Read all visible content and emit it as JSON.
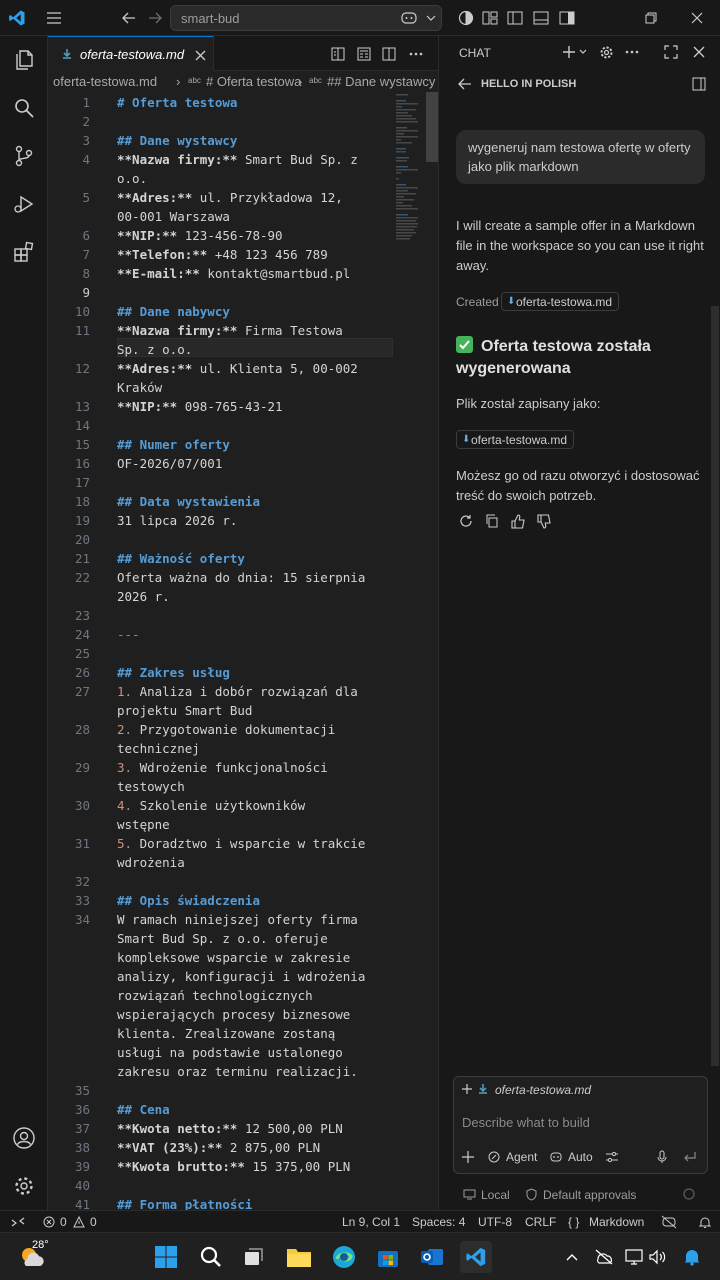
{
  "titlebar": {
    "search_text": "smart-bud"
  },
  "tab": {
    "label": "oferta-testowa.md"
  },
  "breadcrumb": {
    "file": "oferta-testowa.md",
    "sep": "›",
    "item1": "# Oferta testowa",
    "item2": "## Dane wystawcy",
    "abc": "abc"
  },
  "code_lines": [
    {
      "n": "1",
      "html": "<span class='h'># Oferta testowa</span>",
      "row": 0
    },
    {
      "n": "2",
      "html": "",
      "row": 1
    },
    {
      "n": "3",
      "html": "<span class='h'>## Dane wystawcy</span>",
      "row": 2
    },
    {
      "n": "4",
      "html": "<span class='b'>**Nazwa firmy:**</span> Smart Bud Sp. z\no.o.",
      "row": 3
    },
    {
      "n": "5",
      "html": "<span class='b'>**Adres:**</span> ul. Przykładowa 12,\n00-001 Warszawa",
      "row": 5
    },
    {
      "n": "6",
      "html": "<span class='b'>**NIP:**</span> 123-456-78-90",
      "row": 7
    },
    {
      "n": "7",
      "html": "<span class='b'>**Telefon:**</span> +48 123 456 789",
      "row": 8
    },
    {
      "n": "8",
      "html": "<span class='b'>**E-mail:**</span> kontakt@smartbud.pl",
      "row": 9
    },
    {
      "n": "9",
      "html": "",
      "row": 10,
      "cur": true
    },
    {
      "n": "10",
      "html": "<span class='h'>## Dane nabywcy</span>",
      "row": 11
    },
    {
      "n": "11",
      "html": "<span class='b'>**Nazwa firmy:**</span> Firma Testowa\nSp. z o.o.",
      "row": 12
    },
    {
      "n": "12",
      "html": "<span class='b'>**Adres:**</span> ul. Klienta 5, 00-002\nKraków",
      "row": 14
    },
    {
      "n": "13",
      "html": "<span class='b'>**NIP:**</span> 098-765-43-21",
      "row": 16
    },
    {
      "n": "14",
      "html": "",
      "row": 17
    },
    {
      "n": "15",
      "html": "<span class='h'>## Numer oferty</span>",
      "row": 18
    },
    {
      "n": "16",
      "html": "OF-2026/07/001",
      "row": 19
    },
    {
      "n": "17",
      "html": "",
      "row": 20
    },
    {
      "n": "18",
      "html": "<span class='h'>## Data wystawienia</span>",
      "row": 21
    },
    {
      "n": "19",
      "html": "31 lipca 2026 r.",
      "row": 22
    },
    {
      "n": "20",
      "html": "",
      "row": 23
    },
    {
      "n": "21",
      "html": "<span class='h'>## Ważność oferty</span>",
      "row": 24
    },
    {
      "n": "22",
      "html": "Oferta ważna do dnia: 15 sierpnia\n2026 r.",
      "row": 25
    },
    {
      "n": "23",
      "html": "",
      "row": 27
    },
    {
      "n": "24",
      "html": "<span class='hr'>---</span>",
      "row": 28
    },
    {
      "n": "25",
      "html": "",
      "row": 29
    },
    {
      "n": "26",
      "html": "<span class='h'>## Zakres usług</span>",
      "row": 30
    },
    {
      "n": "27",
      "html": "<span class='num'>1.</span> Analiza i dobór rozwiązań dla\nprojektu Smart Bud",
      "row": 31
    },
    {
      "n": "28",
      "html": "<span class='num'>2.</span> Przygotowanie dokumentacji\ntechnicznej",
      "row": 33
    },
    {
      "n": "29",
      "html": "<span class='num'>3.</span> Wdrożenie funkcjonalności\ntestowych",
      "row": 35
    },
    {
      "n": "30",
      "html": "<span class='num'>4.</span> Szkolenie użytkowników\nwstępne",
      "row": 37
    },
    {
      "n": "31",
      "html": "<span class='num'>5.</span> Doradztwo i wsparcie w trakcie\nwdrożenia",
      "row": 39
    },
    {
      "n": "32",
      "html": "",
      "row": 41
    },
    {
      "n": "33",
      "html": "<span class='h'>## Opis świadczenia</span>",
      "row": 42
    },
    {
      "n": "34",
      "html": "W ramach niniejszej oferty firma\nSmart Bud Sp. z o.o. oferuje\nkompleksowe wsparcie w zakresie\nanalizy, konfiguracji i wdrożenia\nrozwiązań technologicznych\nwspierających procesy biznesowe\nklienta. Zrealizowane zostaną\nusługi na podstawie ustalonego\nzakresu oraz terminu realizacji.",
      "row": 43
    },
    {
      "n": "35",
      "html": "",
      "row": 52
    },
    {
      "n": "36",
      "html": "<span class='h'>## Cena</span>",
      "row": 53
    },
    {
      "n": "37",
      "html": "<span class='b'>**Kwota netto:**</span> 12 500,00 PLN",
      "row": 54
    },
    {
      "n": "38",
      "html": "<span class='b'>**VAT (23%):**</span> 2 875,00 PLN",
      "row": 55
    },
    {
      "n": "39",
      "html": "<span class='b'>**Kwota brutto:**</span> 15 375,00 PLN",
      "row": 56
    },
    {
      "n": "40",
      "html": "",
      "row": 57
    },
    {
      "n": "41",
      "html": "<span class='h'>## Forma płatności</span>",
      "row": 58
    }
  ],
  "chat": {
    "panel_title": "CHAT",
    "session_title": "HELLO IN POLISH",
    "user_message": "wygeneruj nam testowa ofertę w oferty jako plik markdown",
    "assistant_intro": "I will create a sample offer in a Markdown file in the workspace so you can use it right away.",
    "created_label": "Created",
    "created_file": "oferta-testowa.md",
    "heading": "Oferta testowa została wygenerowana",
    "saved_as": "Plik został zapisany jako:",
    "saved_file": "oferta-testowa.md",
    "closing": "Możesz go od razu otworzyć i dostosować treść do swoich potrzeb.",
    "attachment": "oferta-testowa.md",
    "input_placeholder": "Describe what to build",
    "mode": "Agent",
    "model": "Auto",
    "location": "Local",
    "approvals": "Default approvals"
  },
  "status": {
    "errors": "0",
    "warnings": "0",
    "position": "Ln 9, Col 1",
    "spaces": "Spaces: 4",
    "encoding": "UTF-8",
    "eol": "CRLF",
    "braces": "{ }",
    "language": "Markdown"
  },
  "taskbar": {
    "temperature": "28°"
  }
}
